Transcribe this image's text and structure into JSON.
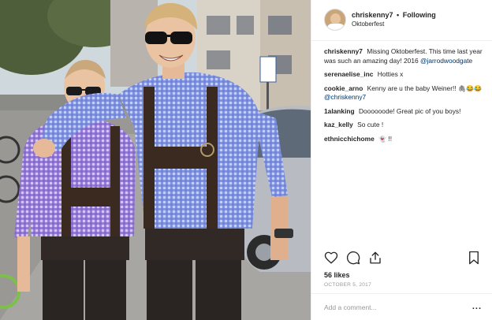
{
  "post": {
    "username": "chriskenny7",
    "follow_status": "Following",
    "location": "Oktoberfest",
    "photo_description": "Two men in blue gingham shirts and lederhosen posing on a city street"
  },
  "comments": [
    {
      "user": "chriskenny7",
      "text": "Missing Oktoberfest. This time last year was such an amazing day! 2016",
      "mention": "@jarrodwoodgate"
    },
    {
      "user": "serenaelise_inc",
      "text": "Hotties x"
    },
    {
      "user": "cookie_arno",
      "text": "Kenny are u the baby Weiner!!",
      "emoji": "🖇😂😂",
      "mention": "@chriskenny7"
    },
    {
      "user": "1alanking",
      "text": "Doooooode! Great pic of you boys!"
    },
    {
      "user": "kaz_kelly",
      "text": "So cute !"
    },
    {
      "user": "ethnicchichome",
      "text": "!!",
      "emoji": "👻"
    }
  ],
  "actions": {
    "like_icon": "heart-icon",
    "comment_icon": "comment-icon",
    "share_icon": "share-icon",
    "save_icon": "bookmark-icon"
  },
  "likes": "56 likes",
  "date": "OCTOBER 5, 2017",
  "add_comment": {
    "placeholder": "Add a comment...",
    "more_label": "..."
  }
}
